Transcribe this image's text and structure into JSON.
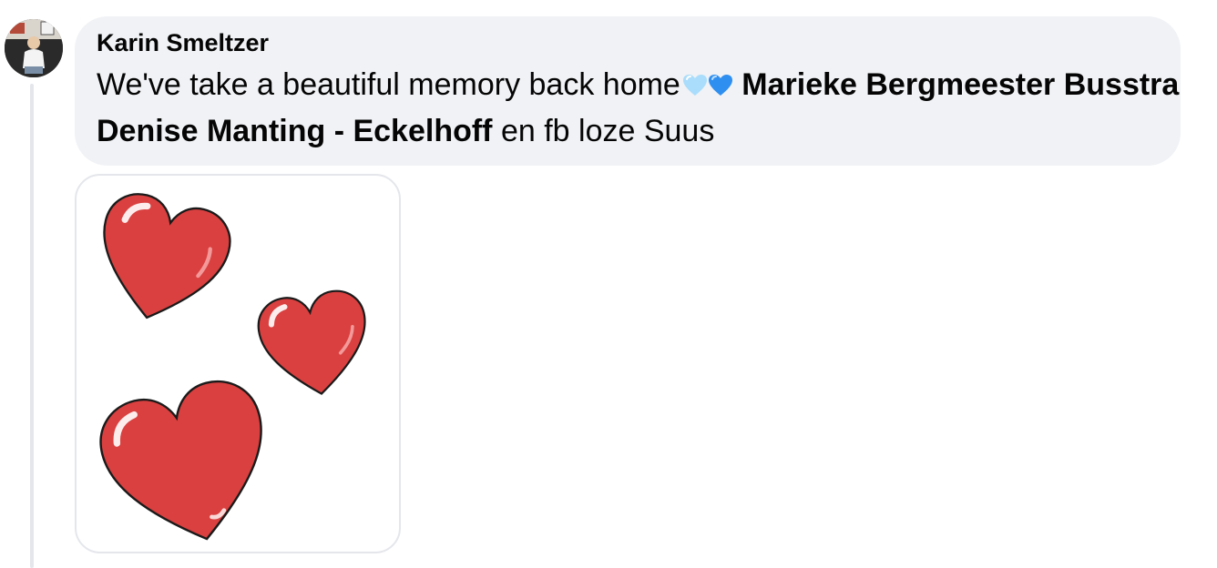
{
  "comment": {
    "author": "Karin Smeltzer",
    "text_before": "We've take a beautiful memory back home",
    "emojis": [
      "light-blue-heart-icon",
      "blue-heart-icon"
    ],
    "mention_1": "Marieke Bergmeester Busstra",
    "mention_2": "Denise Manting - Eckelhoff",
    "text_after": " en fb loze Suus"
  },
  "sticker": {
    "icon": "three-red-hearts-sticker",
    "color": "#d9403f"
  },
  "colors": {
    "bubble": "#f0f2f5",
    "thread_line": "#e4e6eb",
    "light_blue_heart": "#a9ddfb",
    "blue_heart": "#2f8ff0"
  }
}
